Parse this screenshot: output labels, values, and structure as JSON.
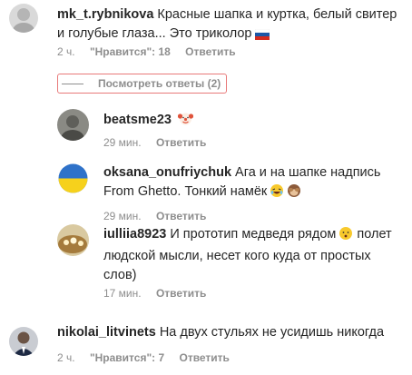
{
  "comments": [
    {
      "username": "mk_t.rybnikova",
      "text": "Красные шапка и куртка, белый свитер и голубые глаза... Это триколор",
      "emoji": "russia-flag",
      "time": "2 ч.",
      "likes": "\"Нравится\": 18",
      "reply_label": "Ответить"
    }
  ],
  "view_replies_label": "Посмотреть ответы (2)",
  "replies": [
    {
      "username": "beatsme23",
      "text": "",
      "emoji": "clown-face",
      "time": "29 мин.",
      "reply_label": "Ответить"
    },
    {
      "username": "oksana_onufriychuk",
      "text": "Ага и на шапке надпись From Ghetto. Тонкий намёк",
      "emoji": "laughing-and-see-no-evil-monkey",
      "time": "29 мин.",
      "reply_label": "Ответить"
    },
    {
      "username": "iulliia8923",
      "text": "И прототип медведя рядом",
      "text_after": "полет людской мысли, несет кого куда от простых слов)",
      "emoji": "hushed-face",
      "time": "17 мин.",
      "reply_label": "Ответить"
    }
  ],
  "last_comment": {
    "username": "nikolai_litvinets",
    "text": "На двух стульях не усидишь никогда",
    "time": "2 ч.",
    "likes": "\"Нравится\": 7",
    "reply_label": "Ответить"
  },
  "colors": {
    "text": "#262626",
    "secondary": "#8e8e8e",
    "highlight_border": "#e87979"
  }
}
